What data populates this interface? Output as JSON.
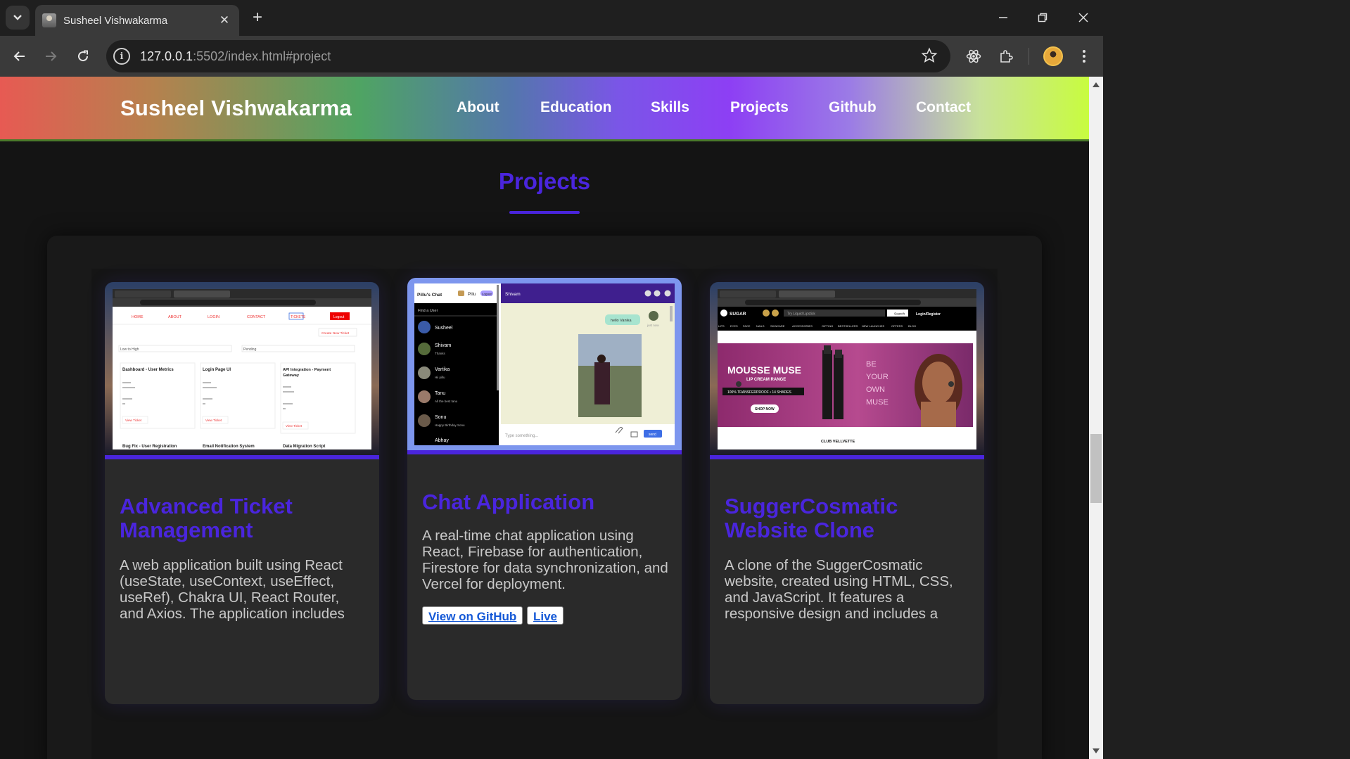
{
  "browser": {
    "tab_title": "Susheel Vishwakarma",
    "url_host": "127.0.0.1",
    "url_rest": ":5502/index.html#project"
  },
  "site": {
    "brand": "Susheel Vishwakarma",
    "nav": [
      "About",
      "Education",
      "Skills",
      "Projects",
      "Github",
      "Contact"
    ]
  },
  "projects": {
    "title": "Projects",
    "cards": [
      {
        "title": "Advanced Ticket Management",
        "description": "A web application built using React (useState, useContext, useEffect, useRef), Chakra UI, React Router, and Axios. The application includes",
        "screenshot": {
          "nav": [
            "HOME",
            "ABOUT",
            "LOGIN",
            "CONTACT",
            "TICKETS"
          ],
          "logout": "Logout",
          "create": "Create New Ticket",
          "sort": "Low to High",
          "filter": "Pending",
          "tickets": [
            {
              "name": "Dashboard - User Metrics",
              "btn": "View Ticket"
            },
            {
              "name": "Login Page UI",
              "btn": "View Ticket"
            },
            {
              "name": "API Integration - Payment Gateway",
              "btn": "View Ticket"
            }
          ],
          "bottom": [
            "Bug Fix - User Registration",
            "Email Notification System",
            "Data Migration Script"
          ]
        }
      },
      {
        "title": "Chat Application",
        "description": "A real-time chat application using React, Firebase for authentication, Firestore for data synchronization, and Vercel for deployment.",
        "github_label": "View on GitHub",
        "live_label": "Live",
        "screenshot": {
          "app": "Pillu's Chat",
          "user": "Pillu",
          "logout": "Logout",
          "find": "Find a User",
          "chat_with": "Shivam",
          "contacts": [
            {
              "name": "Susheel",
              "msg": ""
            },
            {
              "name": "Shivam",
              "msg": "Thanks"
            },
            {
              "name": "Vartika",
              "msg": "Hii pillu"
            },
            {
              "name": "Tanu",
              "msg": "All the best tanu"
            },
            {
              "name": "Sonu",
              "msg": "Happy Birthday Sonu"
            },
            {
              "name": "Abhay",
              "msg": ""
            }
          ],
          "bubble": "hello Vanika",
          "time": "just now",
          "input": "Type something...",
          "send": "send"
        }
      },
      {
        "title": "SuggerCosmatic Website Clone",
        "description": "A clone of the SuggerCosmatic website, created using HTML, CSS, and JavaScript. It features a responsive design and includes a",
        "screenshot": {
          "brand": "SUGAR",
          "search": "Try Liquid Lipstick",
          "search_btn": "Search",
          "login": "Login/Register",
          "cats": [
            "LIPS",
            "EYES",
            "FACE",
            "NAILS",
            "SKINCARE",
            "ACCESSORIES",
            "GIFTING",
            "BESTSELLERS",
            "NEW LAUNCHES",
            "OFFERS",
            "BLOG"
          ],
          "banner_title": "MOUSSE MUSE",
          "banner_sub": "LIP CREAM RANGE",
          "banner_line": "100% TRANSFERPROOF • 14 SHADES",
          "shop": "SHOP NOW",
          "tagline": "BE YOUR OWN MUSE",
          "footer": "CLUB VELLVETTE"
        }
      }
    ]
  },
  "colors": {
    "accent": "#4a25dd",
    "page_bg": "#141414",
    "card_bg": "#2a2a2a",
    "link": "#1458d6"
  }
}
